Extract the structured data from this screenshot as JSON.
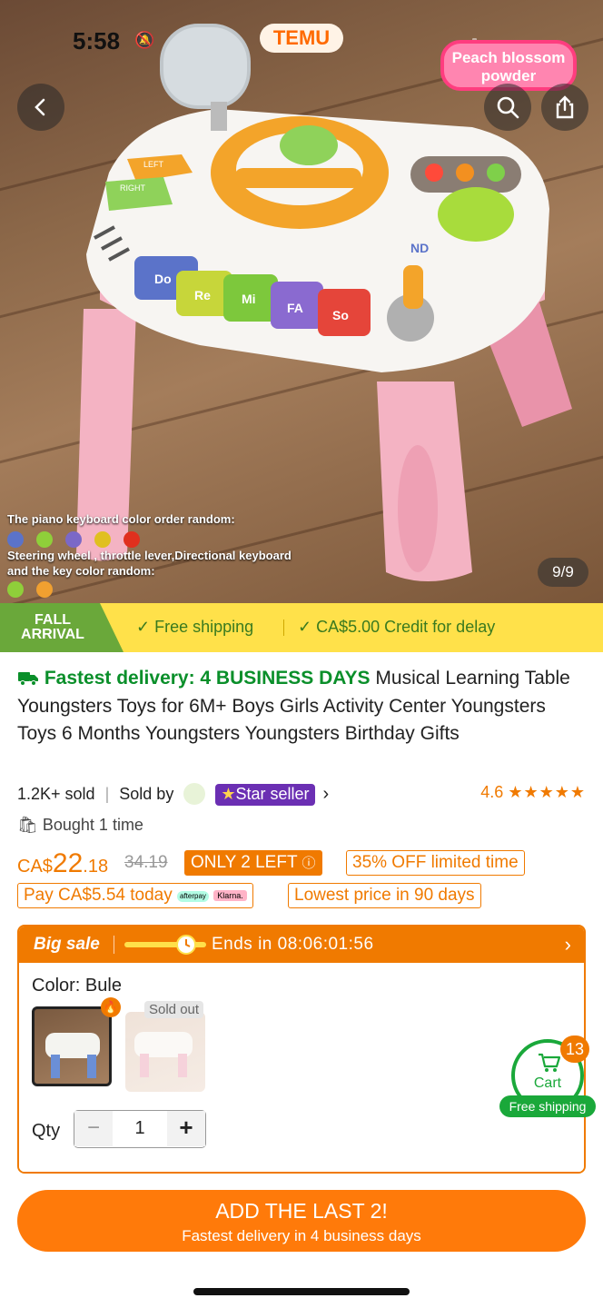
{
  "status": {
    "time": "5:58",
    "app_badge": "TEMU"
  },
  "hero": {
    "tag": "Peach blossom powder",
    "counter": "9/9",
    "caption_keyboard": "The piano keyboard color order random:",
    "caption_wheel_1": "Steering wheel , throttle lever,Directional keyboard",
    "caption_wheel_2": "and the key color random:",
    "toy_left": "LEFT",
    "toy_right": "RIGHT",
    "toy_keys": [
      "Do",
      "Re",
      "Mi",
      "FA",
      "So"
    ],
    "toy_gear": "ND",
    "keyboard_colors": [
      "#5b73c9",
      "#8fcf3a",
      "#7b68c7",
      "#e0c020",
      "#e0301e"
    ],
    "wheel_colors": [
      "#8fcf3a",
      "#f0a030"
    ]
  },
  "promo": {
    "badge_line1": "FALL",
    "badge_line2": "ARRIVAL",
    "free_shipping": "Free shipping",
    "credit": "CA$5.00 Credit for delay"
  },
  "product": {
    "fastest": "Fastest delivery: 4 BUSINESS DAYS",
    "title": "Musical Learning Table Youngsters Toys for 6M+ Boys Girls Activity Center Youngsters Toys 6 Months Youngsters Youngsters Birthday Gifts",
    "sold": "1.2K+ sold",
    "sold_by": "Sold by",
    "star_seller": "Star seller",
    "rating": "4.6",
    "bought": "Bought 1 time"
  },
  "price": {
    "currency": "CA$",
    "whole": "22",
    "cents": ".18",
    "original": "34.19",
    "only_left": "ONLY 2 LEFT",
    "discount": "35% OFF limited time",
    "pay_today": "Pay CA$5.54 today",
    "afterpay": "afterpay",
    "klarna": "Klarna.",
    "lowest": "Lowest price in 90 days"
  },
  "sale": {
    "label": "Big sale",
    "ends": "Ends in 08:06:01:56",
    "color_label": "Color: Bule",
    "sold_out": "Sold out",
    "qty_label": "Qty",
    "qty_value": "1"
  },
  "cart": {
    "label": "Cart",
    "count": "13",
    "free": "Free shipping"
  },
  "cta": {
    "main": "ADD THE LAST 2!",
    "sub": "Fastest delivery in 4 business days"
  }
}
